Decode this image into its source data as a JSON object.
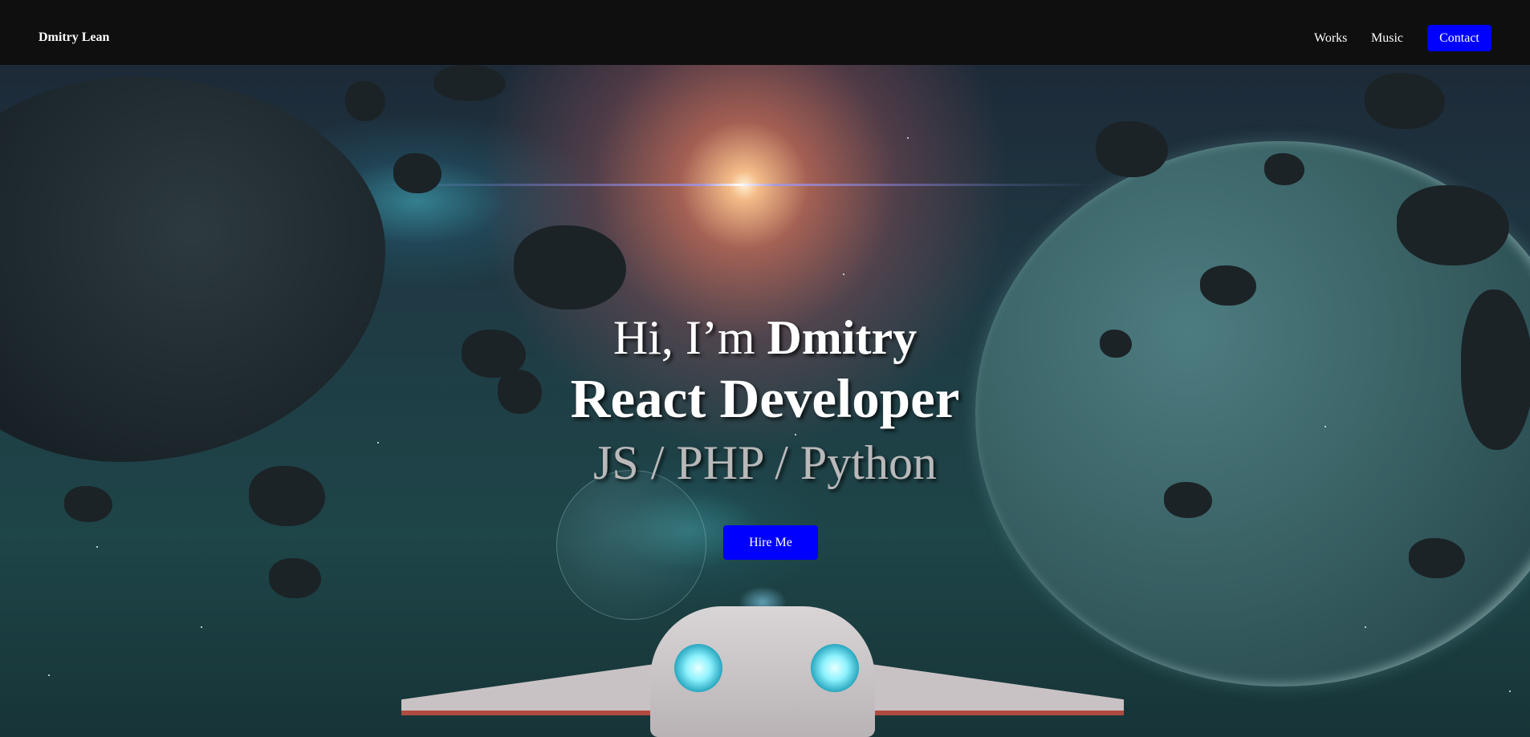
{
  "header": {
    "brand": "Dmitry Lean",
    "nav": [
      {
        "label": "Works"
      },
      {
        "label": "Music"
      }
    ],
    "contact_label": "Contact"
  },
  "hero": {
    "greeting_prefix": "Hi, I’m ",
    "greeting_name": "Dmitry",
    "role": "React Developer",
    "stack": "JS / PHP / Python",
    "cta_label": "Hire Me"
  },
  "colors": {
    "button_blue": "#0000ff",
    "header_bg": "#0f0f10",
    "text_white": "#ffffff",
    "stack_gray": "#b9b9b9"
  }
}
